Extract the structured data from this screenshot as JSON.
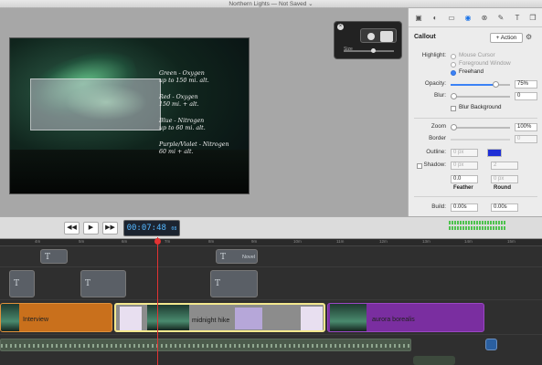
{
  "window": {
    "title": "Northern Lights — Not Saved ⌄"
  },
  "canvas": {
    "notes": [
      {
        "line1": "Green - Oxygen",
        "line2": "up to 150 mi. alt."
      },
      {
        "line1": "Red - Oxygen",
        "line2": "150 mi. + alt."
      },
      {
        "line1": "Blue - Nitrogen",
        "line2": "up to 60 mi. alt."
      },
      {
        "line1": "Purple/Violet - Nitrogen",
        "line2": "60 mi + alt."
      }
    ],
    "hud": {
      "close": "×",
      "size_label": "Size"
    }
  },
  "inspector": {
    "section_title": "Callout",
    "action_label": "+ Action",
    "gear": "⚙",
    "highlight_label": "Highlight:",
    "highlight_options": [
      "Mouse Cursor",
      "Foreground Window",
      "Freehand"
    ],
    "opacity_label": "Opacity:",
    "opacity_value": "75%",
    "opacity_level": 0.75,
    "blur_label": "Blur:",
    "blur_value": "0",
    "blur_background_label": "Blur Background",
    "zoom_label": "Zoom",
    "zoom_value": "100%",
    "border_label": "Border",
    "border_value": "0",
    "outline_label": "Outline:",
    "outline_value": "0 px",
    "outline_color": "#1f2fd6",
    "shadow_label": "Shadow:",
    "shadow_value": "0 px",
    "shadow_value2": "2",
    "feather_value": "0.0",
    "round_value": "0 px",
    "feather_label": "Feather",
    "round_label": "Round",
    "build_label": "Build:",
    "build_in": "0.00s",
    "build_out": "0.00s"
  },
  "transport": {
    "rewind": "◀◀",
    "play": "▶",
    "forward": "▶▶",
    "timecode": "00:07:48",
    "timecode_frames": "08"
  },
  "ruler": {
    "ticks": [
      "4m",
      "5m",
      "6m",
      "7m",
      "8m",
      "9m",
      "10m",
      "11m",
      "12m",
      "13m",
      "14m",
      "15m",
      "16m"
    ]
  },
  "timeline": {
    "caption_clip_label": "T",
    "caption_clip_text": "Novel",
    "clips": [
      {
        "label": "Interview"
      },
      {
        "label": "midnight hike"
      },
      {
        "label": "aurora borealis"
      }
    ]
  },
  "colors": {
    "accent": "#3b82f6",
    "timecode": "#55b7ff",
    "playhead": "#e23333"
  }
}
